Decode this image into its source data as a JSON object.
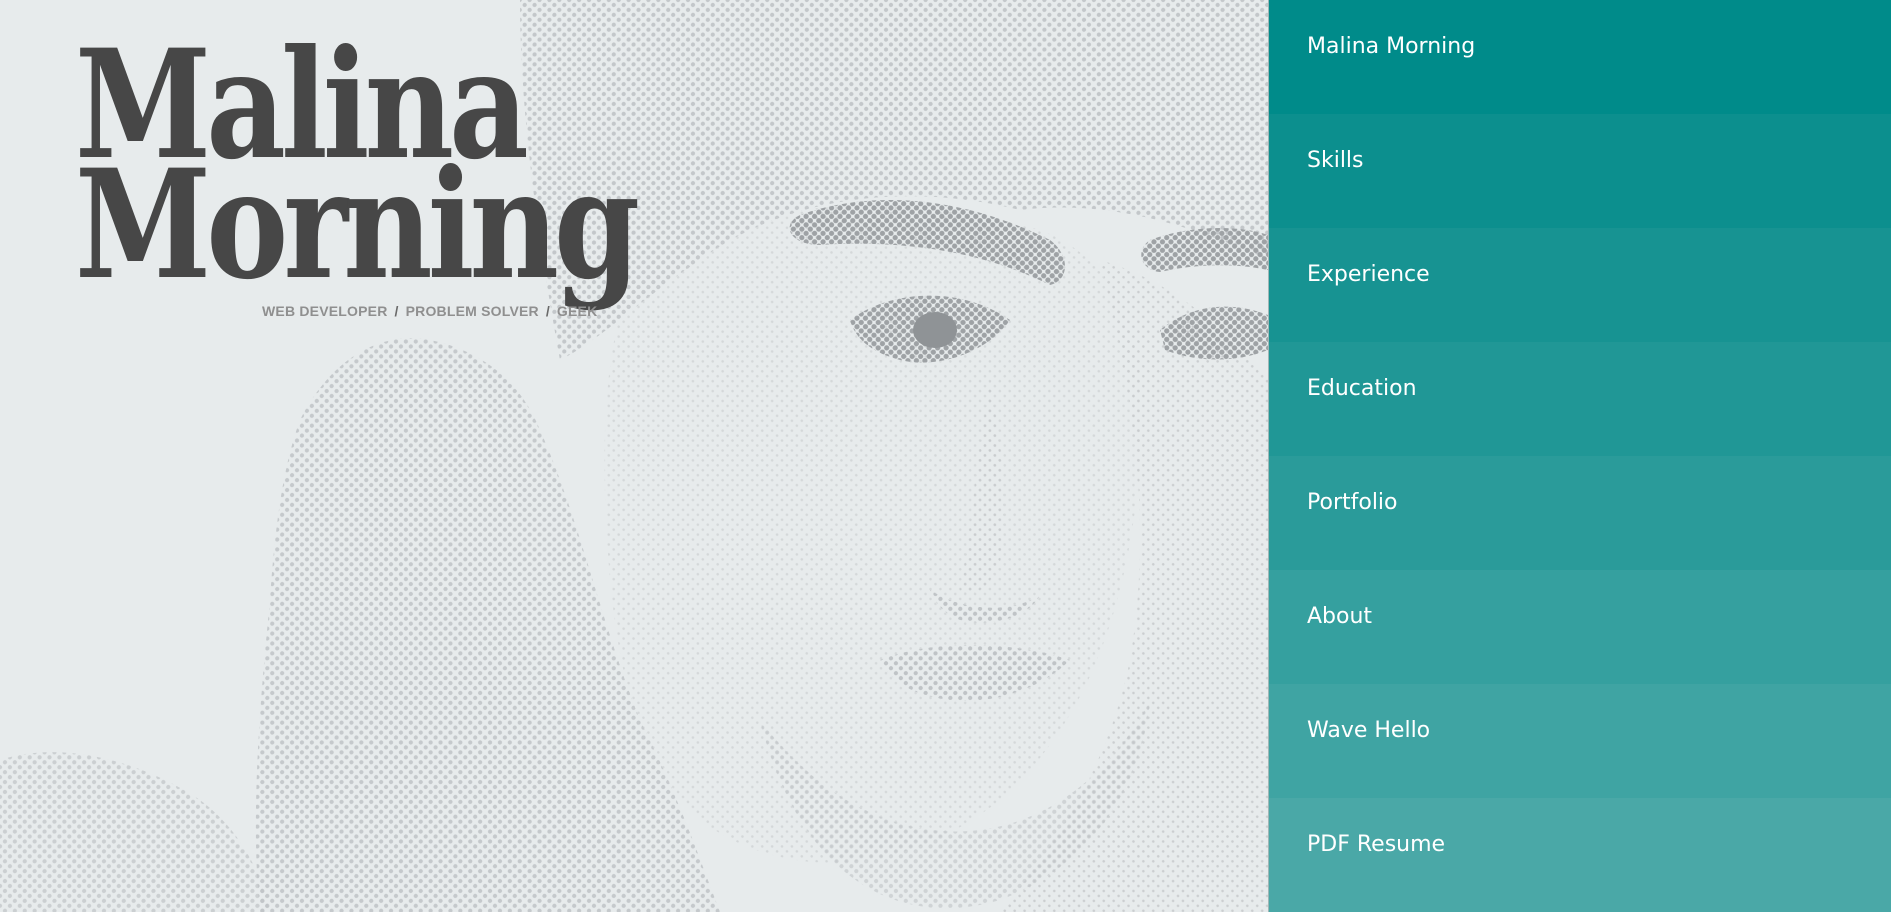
{
  "brand": {
    "name_line1": "Malina",
    "name_line2": "Morning",
    "tagline": [
      "WEB DEVELOPER",
      "PROBLEM SOLVER",
      "GEEK"
    ],
    "tagline_separator": "/"
  },
  "nav": {
    "items": [
      {
        "label": "Malina Morning",
        "color": "#008b8a"
      },
      {
        "label": "Skills",
        "color": "#0c8f8e"
      },
      {
        "label": "Experience",
        "color": "#179392"
      },
      {
        "label": "Education",
        "color": "#209796"
      },
      {
        "label": "Portfolio",
        "color": "#2a9b9a"
      },
      {
        "label": "About",
        "color": "#35a09f"
      },
      {
        "label": "Wave Hello",
        "color": "#3fa4a3"
      },
      {
        "label": "PDF Resume",
        "color": "#4aa8a7"
      }
    ]
  },
  "colors": {
    "background": "#e7ebec",
    "logo": "#474747",
    "tagline": "#8f8f8f",
    "halftone": "#c4c7c9"
  }
}
